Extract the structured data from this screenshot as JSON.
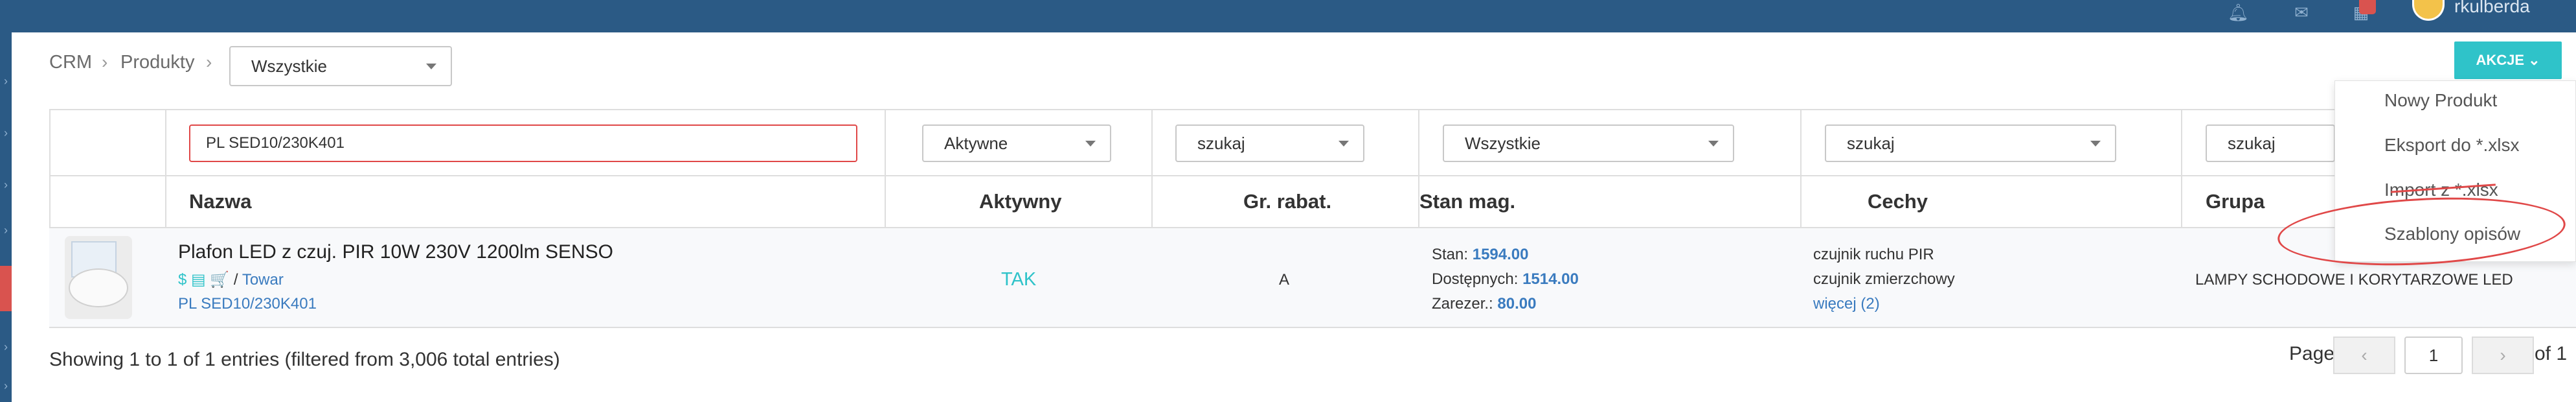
{
  "topbar": {
    "user_name": "rkulberda",
    "icons": [
      "bell-icon",
      "mail-icon",
      "calendar-icon"
    ]
  },
  "breadcrumb": {
    "root": "CRM",
    "current": "Produkty",
    "filter_value": "Wszystkie"
  },
  "actions": {
    "button_label": "AKCJE",
    "menu": [
      "Nowy Produkt",
      "Eksport do *.xlsx",
      "Import z *.xlsx",
      "Szablony opisów"
    ]
  },
  "filters": {
    "name_search": "PL SED10/230K401",
    "active": "Aktywne",
    "rabat": "szukaj",
    "stock": "Wszystkie",
    "features": "szukaj",
    "group": "szukaj"
  },
  "table": {
    "headers": [
      "Nazwa",
      "Aktywny",
      "Gr. rabat.",
      "Stan mag.",
      "Cechy",
      "Grupa"
    ],
    "rows": [
      {
        "name": "Plafon LED z czuj. PIR 10W 230V 1200lm SENSO",
        "icons": "$ ▤ 🛒",
        "type_sep": "/",
        "type": "Towar",
        "code": "PL SED10/230K401",
        "active": "TAK",
        "rabat": "A",
        "stan_label": "Stan:",
        "stan_value": "1594.00",
        "dost_label": "Dostępnych:",
        "dost_value": "1514.00",
        "zarez_label": "Zarezer.:",
        "zarez_value": "80.00",
        "feature1": "czujnik ruchu PIR",
        "feature2": "czujnik zmierzchowy",
        "more": "więcej (2)",
        "group": "LAMPY SCHODOWE I KORYTARZOWE LED"
      }
    ]
  },
  "footer": {
    "info": "Showing 1 to 1 of 1 entries (filtered from 3,006 total entries)",
    "page_label": "Page",
    "page_value": "1",
    "of_label": "of 1",
    "prev": "‹",
    "next": "›"
  },
  "colors": {
    "topbar": "#2b5a85",
    "accent": "#2fc3c9",
    "alert": "#e04848",
    "link": "#3a7bbf"
  }
}
